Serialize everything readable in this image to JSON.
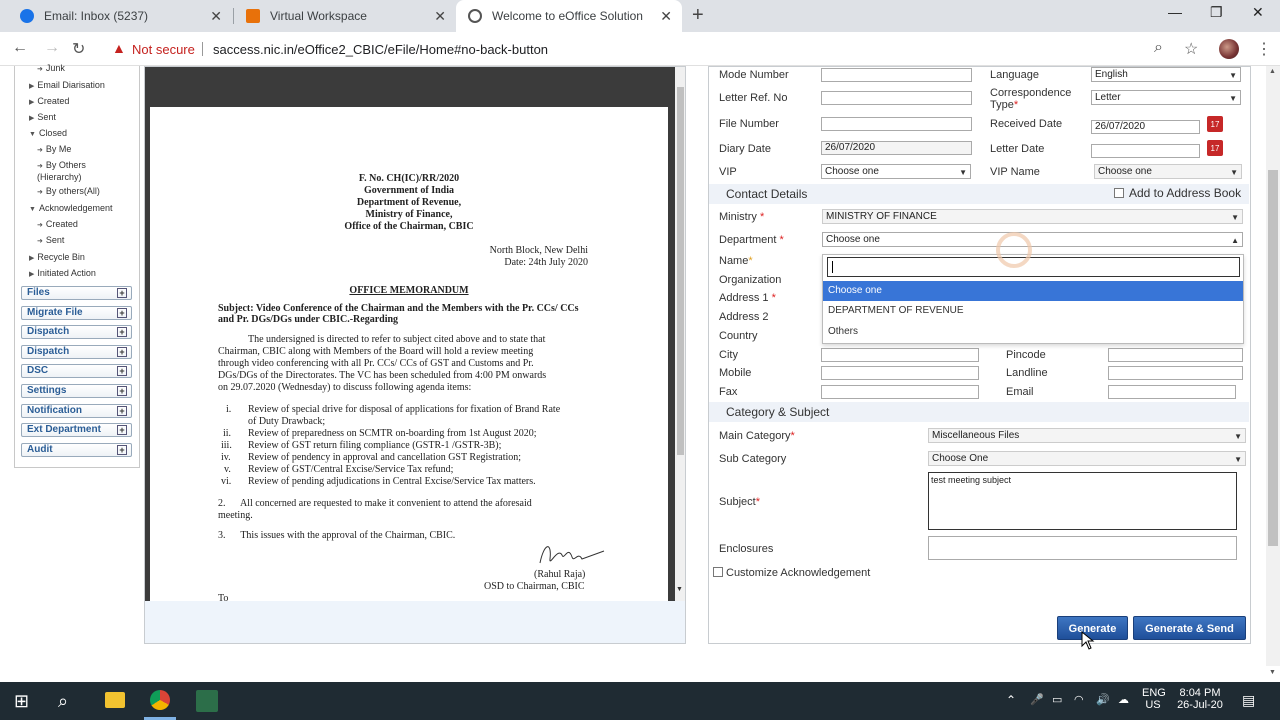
{
  "browser": {
    "tabs": [
      {
        "title": "Email: Inbox (5237)",
        "active": false
      },
      {
        "title": "Virtual Workspace",
        "active": false
      },
      {
        "title": "Welcome to eOffice Solution",
        "active": true
      }
    ],
    "security_label": "Not secure",
    "url": "saccess.nic.in/eOffice2_CBIC/eFile/Home#no-back-button"
  },
  "sidebar": {
    "tree": [
      {
        "label": "Junk",
        "indent": 2
      },
      {
        "label": "Email Diarisation",
        "indent": 1
      },
      {
        "label": "Created",
        "indent": 1
      },
      {
        "label": "Sent",
        "indent": 1
      },
      {
        "label": "Closed",
        "indent": 1
      },
      {
        "label": "By Me",
        "indent": 2
      },
      {
        "label": "By Others (Hierarchy)",
        "indent": 2
      },
      {
        "label": "By others(All)",
        "indent": 2
      },
      {
        "label": "Acknowledgement",
        "indent": 1
      },
      {
        "label": "Created",
        "indent": 2
      },
      {
        "label": "Sent",
        "indent": 2
      },
      {
        "label": "Recycle Bin",
        "indent": 1
      },
      {
        "label": "Initiated Action",
        "indent": 1
      }
    ],
    "menus": [
      "Files",
      "Migrate File",
      "Dispatch",
      "Dispatch",
      "DSC",
      "Settings",
      "Notification",
      "Ext Department",
      "Audit"
    ]
  },
  "document": {
    "header_lines": [
      "F. No. CH(IC)/RR/2020",
      "Government of India",
      "Department of Revenue,",
      "Ministry of Finance,",
      "Office of the Chairman, CBIC"
    ],
    "place": "North Block, New Delhi",
    "date": "Date: 24th July 2020",
    "title": "OFFICE MEMORANDUM",
    "subject_line1": "Subject: Video Conference of the Chairman and the Members with the Pr. CCs/ CCs",
    "subject_line2": "and Pr. DGs/DGs under CBIC.-Regarding",
    "para_lines": [
      "The undersigned is directed to refer to subject cited above and to state that",
      "Chairman, CBIC along with Members of the Board will hold a review meeting",
      "through video conferencing with all Pr. CCs/ CCs of GST and Customs and Pr.",
      "DGs/DGs of the Directorates. The VC has been scheduled from 4:00 PM onwards",
      "on 29.07.2020 (Wednesday) to discuss following agenda items:"
    ],
    "agenda": [
      {
        "num": "i.",
        "text": "Review of special drive for disposal of applications for fixation of Brand Rate"
      },
      {
        "num": "",
        "text": "of Duty Drawback;"
      },
      {
        "num": "ii.",
        "text": "Review of preparedness on SCMTR on-boarding from 1st August 2020;"
      },
      {
        "num": "iii.",
        "text": "Review of GST return filing compliance (GSTR-1 /GSTR-3B);"
      },
      {
        "num": "iv.",
        "text": "Review of pendency in approval and cancellation GST Registration;"
      },
      {
        "num": "v.",
        "text": "Review of GST/Central Excise/Service Tax refund;"
      },
      {
        "num": "vi.",
        "text": "Review of pending adjudications in Central Excise/Service Tax matters."
      }
    ],
    "para2_line1": "2.      All concerned are requested to make it convenient to attend the aforesaid",
    "para2_line2": "meeting.",
    "para3": "3.      This issues with the approval of the Chairman, CBIC.",
    "signer": "(Rahul Raja)",
    "signer_title": "OSD to Chairman, CBIC",
    "to": "To"
  },
  "form": {
    "mode_number_label": "Mode Number",
    "letter_ref_label": "Letter Ref. No",
    "file_number_label": "File Number",
    "diary_date_label": "Diary Date",
    "diary_date_value": "26/07/2020",
    "vip_label": "VIP",
    "vip_value": "Choose one",
    "language_label": "Language",
    "language_value": "English",
    "correspondence_type_label": "Correspondence Type",
    "correspondence_type_value": "Letter",
    "received_date_label": "Received Date",
    "received_date_value": "26/07/2020",
    "letter_date_label": "Letter Date",
    "vip_name_label": "VIP Name",
    "vip_name_value": "Choose one",
    "contact_details_title": "Contact Details",
    "add_to_address_book": "Add to Address Book",
    "ministry_label": "Ministry",
    "ministry_value": "MINISTRY OF FINANCE",
    "department_label": "Department",
    "department_value": "Choose one",
    "name_label": "Name",
    "organization_label": "Organization",
    "address1_label": "Address 1",
    "address2_label": "Address 2",
    "country_label": "Country",
    "city_label": "City",
    "pincode_label": "Pincode",
    "mobile_label": "Mobile",
    "landline_label": "Landline",
    "fax_label": "Fax",
    "email_label": "Email",
    "department_options": [
      "Choose one",
      "DEPARTMENT OF REVENUE",
      "Others"
    ],
    "category_title": "Category & Subject",
    "main_category_label": "Main Category",
    "main_category_value": "Miscellaneous Files",
    "sub_category_label": "Sub Category",
    "sub_category_value": "Choose One",
    "subject_label": "Subject",
    "subject_value": "test meeting subject",
    "enclosures_label": "Enclosures",
    "customize_ack": "Customize Acknowledgement",
    "generate": "Generate",
    "generate_send": "Generate & Send"
  },
  "taskbar": {
    "lang": "ENG",
    "region": "US",
    "time": "8:04 PM",
    "date": "26-Jul-20"
  }
}
